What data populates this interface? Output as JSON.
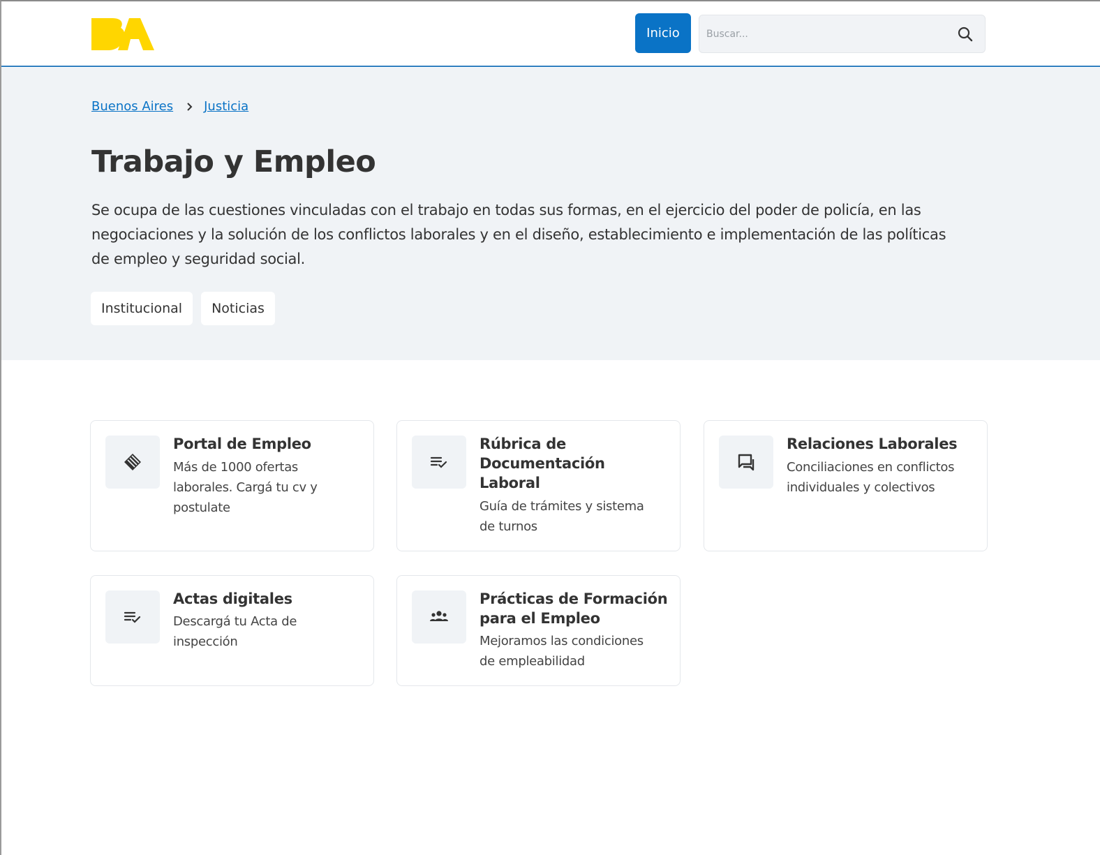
{
  "header": {
    "logo_text": "BA",
    "inicio_label": "Inicio",
    "search_placeholder": "Buscar..."
  },
  "breadcrumb": [
    {
      "label": "Buenos Aires"
    },
    {
      "label": "Justicia"
    }
  ],
  "hero": {
    "title": "Trabajo y Empleo",
    "description_lines": [
      "Se ocupa de las cuestiones vinculadas con el trabajo en todas sus formas, en el ejercicio del poder de policía, en las",
      "negociaciones y la solución de los conflictos laborales y en el diseño, establecimiento e implementación de las políticas",
      "de empleo y seguridad social."
    ],
    "tags": [
      "Institucional",
      "Noticias"
    ]
  },
  "cards": [
    {
      "icon": "handshake-icon",
      "title": "Portal de Empleo",
      "description_lines": [
        "Más de 1000 ofertas",
        "laborales. Cargá tu cv y",
        "postulate"
      ]
    },
    {
      "icon": "checklist-icon",
      "title_lines": [
        "Rúbrica de",
        "Documentación",
        "Laboral"
      ],
      "description_lines": [
        "Guía de trámites y sistema",
        "de turnos"
      ]
    },
    {
      "icon": "chat-icon",
      "title": "Relaciones Laborales",
      "description_lines": [
        "Conciliaciones en conflictos",
        "individuales y colectivos"
      ]
    },
    {
      "icon": "checklist-icon",
      "title": "Actas digitales",
      "description_lines": [
        "Descargá tu Acta de",
        "inspección"
      ]
    },
    {
      "icon": "group-icon",
      "title_lines": [
        "Prácticas de Formación",
        "para el Empleo"
      ],
      "description_lines": [
        "Mejoramos las condiciones",
        "de empleabilidad"
      ]
    }
  ],
  "colors": {
    "brand_yellow": "#FFD600",
    "primary_blue": "#0A73C6",
    "hero_bg": "#F0F3F6"
  }
}
